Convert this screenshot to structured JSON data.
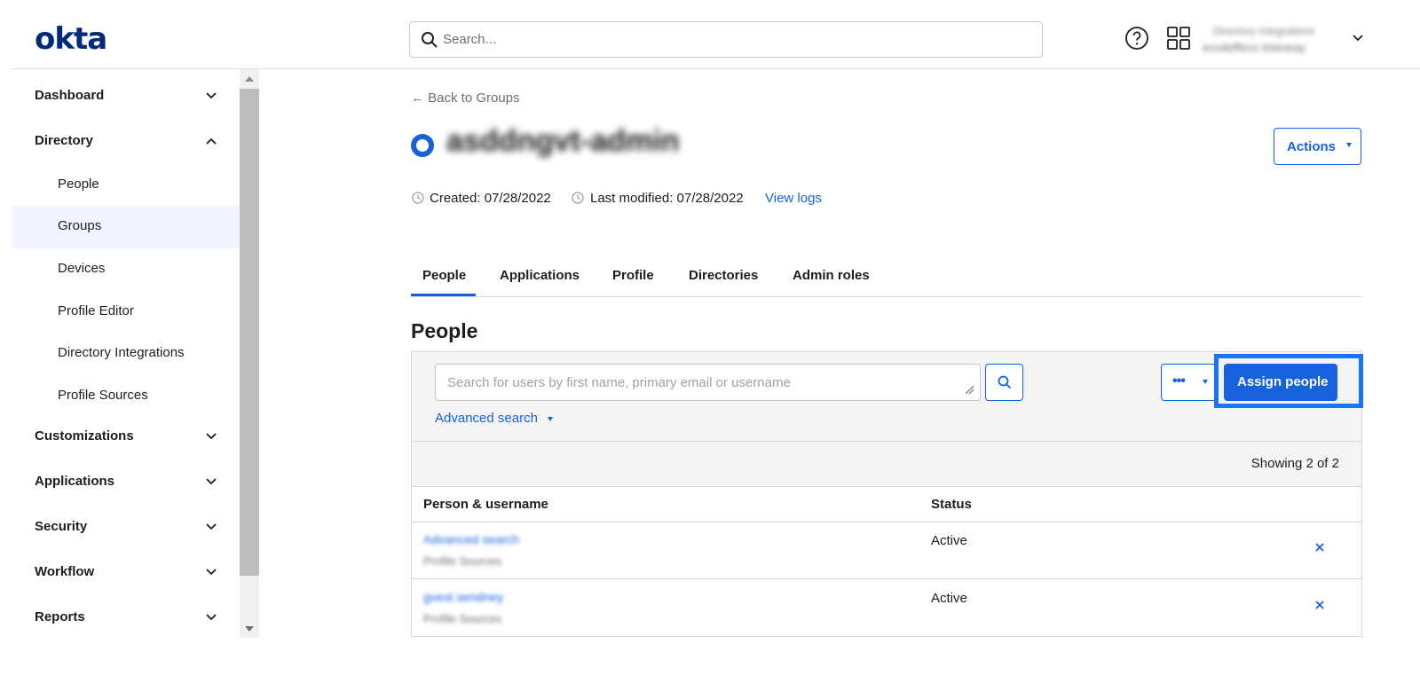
{
  "header": {
    "logo": "okta",
    "search_placeholder": "Search...",
    "org_name": "Directory Integrations",
    "user_name": "ecodeffecs Inteneay"
  },
  "sidebar": {
    "sections": [
      {
        "label": "Dashboard",
        "expanded": false
      },
      {
        "label": "Directory",
        "expanded": true
      },
      {
        "label": "Customizations",
        "expanded": false
      },
      {
        "label": "Applications",
        "expanded": false
      },
      {
        "label": "Security",
        "expanded": false
      },
      {
        "label": "Workflow",
        "expanded": false
      },
      {
        "label": "Reports",
        "expanded": false
      }
    ],
    "directory_items": [
      {
        "label": "People",
        "active": false
      },
      {
        "label": "Groups",
        "active": true
      },
      {
        "label": "Devices",
        "active": false
      },
      {
        "label": "Profile Editor",
        "active": false
      },
      {
        "label": "Directory Integrations",
        "active": false
      },
      {
        "label": "Profile Sources",
        "active": false
      }
    ]
  },
  "group": {
    "back_link": "← Back to Groups",
    "name": "asddngvt-admin",
    "actions_label": "Actions",
    "created": "Created: 07/28/2022",
    "last_modified": "Last modified: 07/28/2022",
    "view_logs": "View logs"
  },
  "tabs": [
    {
      "label": "People",
      "active": true
    },
    {
      "label": "Applications",
      "active": false
    },
    {
      "label": "Profile",
      "active": false
    },
    {
      "label": "Directories",
      "active": false
    },
    {
      "label": "Admin roles",
      "active": false
    }
  ],
  "people": {
    "title": "People",
    "search_placeholder": "Search for users by first name, primary email or username",
    "advanced_search": "Advanced search",
    "more_label": "•••",
    "assign_label": "Assign people",
    "showing": "Showing 2 of 2",
    "columns": [
      "Person & username",
      "Status"
    ],
    "rows": [
      {
        "name": "Advanced search",
        "username": "Profile Sources",
        "status": "Active"
      },
      {
        "name": "gvest sendney",
        "username": "Profile Sources",
        "status": "Active"
      }
    ]
  },
  "colors": {
    "brand": "#00297a",
    "accent": "#1662dd",
    "highlight": "#1a73ff",
    "active_nav_bg": "#f0f4ff"
  }
}
